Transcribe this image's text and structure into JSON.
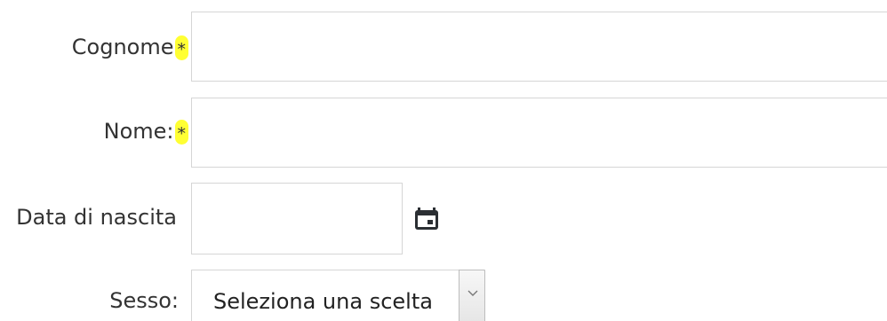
{
  "form": {
    "cognome": {
      "label": "Cognome",
      "required_mark": "*",
      "value": "",
      "placeholder": ""
    },
    "nome": {
      "label": "Nome:",
      "required_mark": "*",
      "value": "",
      "placeholder": ""
    },
    "data_nascita": {
      "label": "Data di nascita",
      "value": "",
      "placeholder": "",
      "icon": "calendar-icon"
    },
    "sesso": {
      "label": "Sesso:",
      "selected": "Seleziona una scelta",
      "icon": "chevron-down-icon"
    }
  },
  "colors": {
    "required_highlight": "#ffff33",
    "text": "#333333",
    "border": "#d6d6d6"
  }
}
